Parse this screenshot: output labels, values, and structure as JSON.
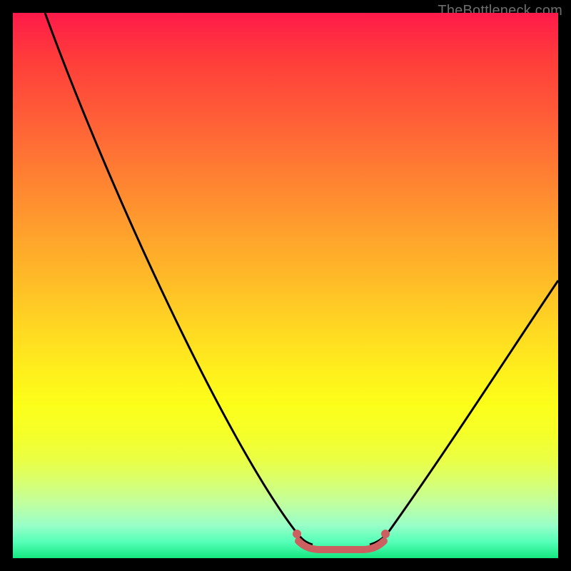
{
  "watermark": "TheBottleneck.com",
  "chart_data": {
    "type": "line",
    "title": "",
    "xlabel": "",
    "ylabel": "",
    "xlim": [
      0,
      100
    ],
    "ylim": [
      0,
      100
    ],
    "series": [
      {
        "name": "bottleneck-curve",
        "x": [
          6,
          12,
          20,
          28,
          36,
          44,
          50,
          54,
          58,
          62,
          66,
          70,
          75,
          82,
          90,
          100
        ],
        "y": [
          100,
          82,
          62,
          45,
          30,
          16,
          6,
          2,
          1,
          1,
          2,
          6,
          16,
          30,
          42,
          51
        ]
      }
    ],
    "highlight": {
      "name": "optimal-range",
      "x_range": [
        52,
        68
      ],
      "y": 1,
      "color": "#cc5f5f"
    },
    "background_gradient": {
      "direction": "vertical",
      "stops": [
        {
          "pos": 0.0,
          "color": "#ff1a4a"
        },
        {
          "pos": 0.5,
          "color": "#ffc225"
        },
        {
          "pos": 0.72,
          "color": "#fcff1a"
        },
        {
          "pos": 1.0,
          "color": "#15e880"
        }
      ]
    }
  }
}
